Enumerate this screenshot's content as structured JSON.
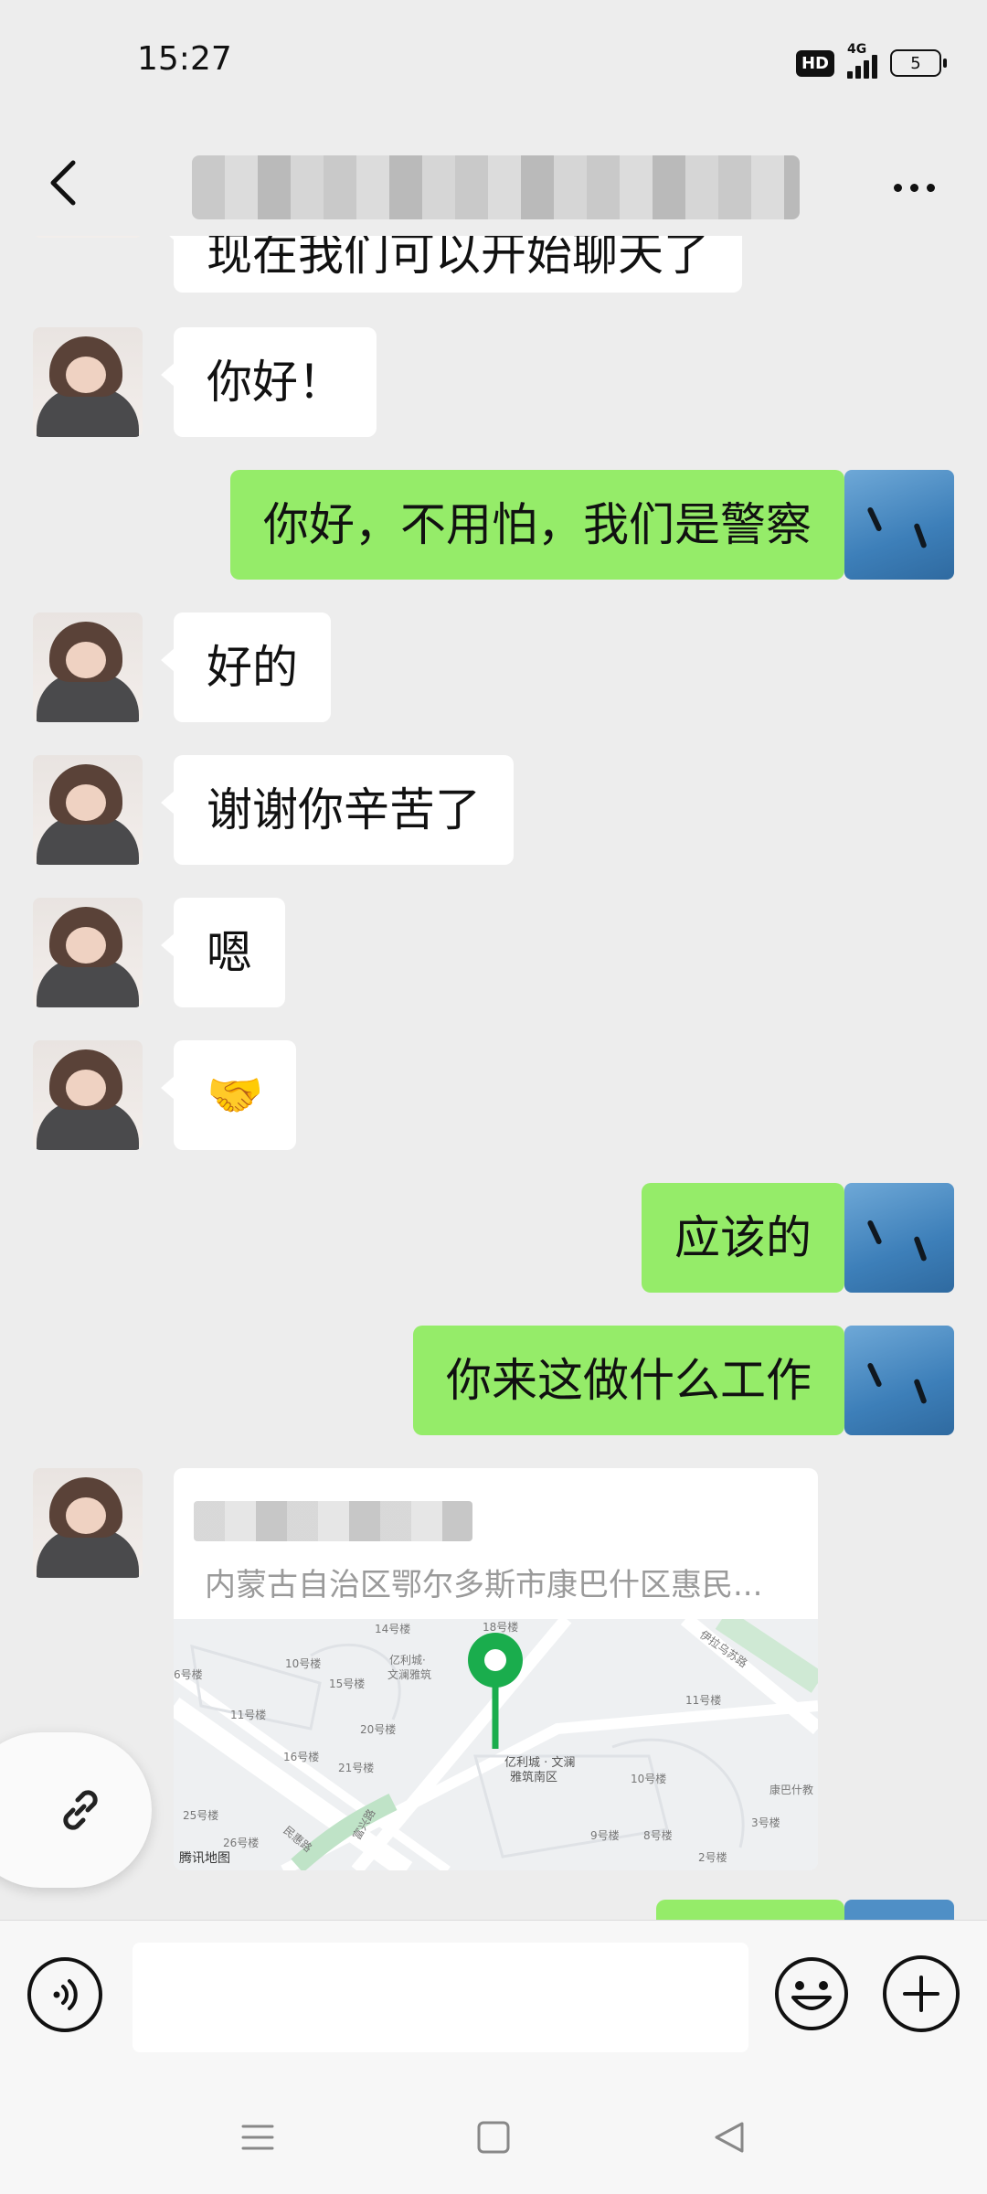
{
  "status_bar": {
    "time": "15:27",
    "hd_label": "HD",
    "network_label": "4G",
    "battery_level": "5"
  },
  "nav": {
    "back_icon": "chevron-left-icon",
    "more_icon": "more-horizontal-icon"
  },
  "messages": [
    {
      "side": "in",
      "text": "现在我们可以开始聊天了"
    },
    {
      "side": "in",
      "text": "你好！"
    },
    {
      "side": "out",
      "text": "你好，不用怕，我们是警察"
    },
    {
      "side": "in",
      "text": "好的"
    },
    {
      "side": "in",
      "text": "谢谢你辛苦了"
    },
    {
      "side": "in",
      "text": "嗯"
    },
    {
      "side": "in",
      "text": "🤝"
    },
    {
      "side": "out",
      "text": "应该的"
    },
    {
      "side": "out",
      "text": "你来这做什么工作"
    }
  ],
  "location_card": {
    "address": "内蒙古自治区鄂尔多斯市康巴什区惠民...",
    "map_credit": "腾讯地图",
    "map_labels": {
      "l1": "14号楼",
      "l2": "18号楼",
      "l3": "10号楼",
      "l4": "亿利城·",
      "l5": "文澜雅筑",
      "l6": "6号楼",
      "l7": "15号楼",
      "l8": "11号楼",
      "l9": "20号楼",
      "l10": "16号楼",
      "l11": "21号楼",
      "l12": "亿利城 · 文澜",
      "l13": "雅筑南区",
      "l14": "11号楼",
      "l15": "10号楼",
      "l16": "伊拉乌苏路",
      "l17": "康巴什教",
      "l18": "3号楼",
      "l19": "9号楼",
      "l20": "8号楼",
      "l21": "2号楼",
      "l22": "25号楼",
      "l23": "26号楼",
      "l24": "民惠路",
      "l25": "富兴路"
    }
  },
  "input_bar": {
    "voice_icon": "voice-icon",
    "emoji_icon": "emoji-icon",
    "plus_icon": "plus-circle-icon",
    "message_placeholder": ""
  },
  "floating": {
    "link_icon": "link-icon"
  },
  "system_nav": {
    "menu_icon": "menu-icon",
    "home_icon": "home-square-icon",
    "back_icon": "back-triangle-icon"
  },
  "colors": {
    "outgoing_bubble": "#95ec69",
    "incoming_bubble": "#ffffff",
    "background": "#ededed",
    "map_pin": "#1aad4d"
  }
}
